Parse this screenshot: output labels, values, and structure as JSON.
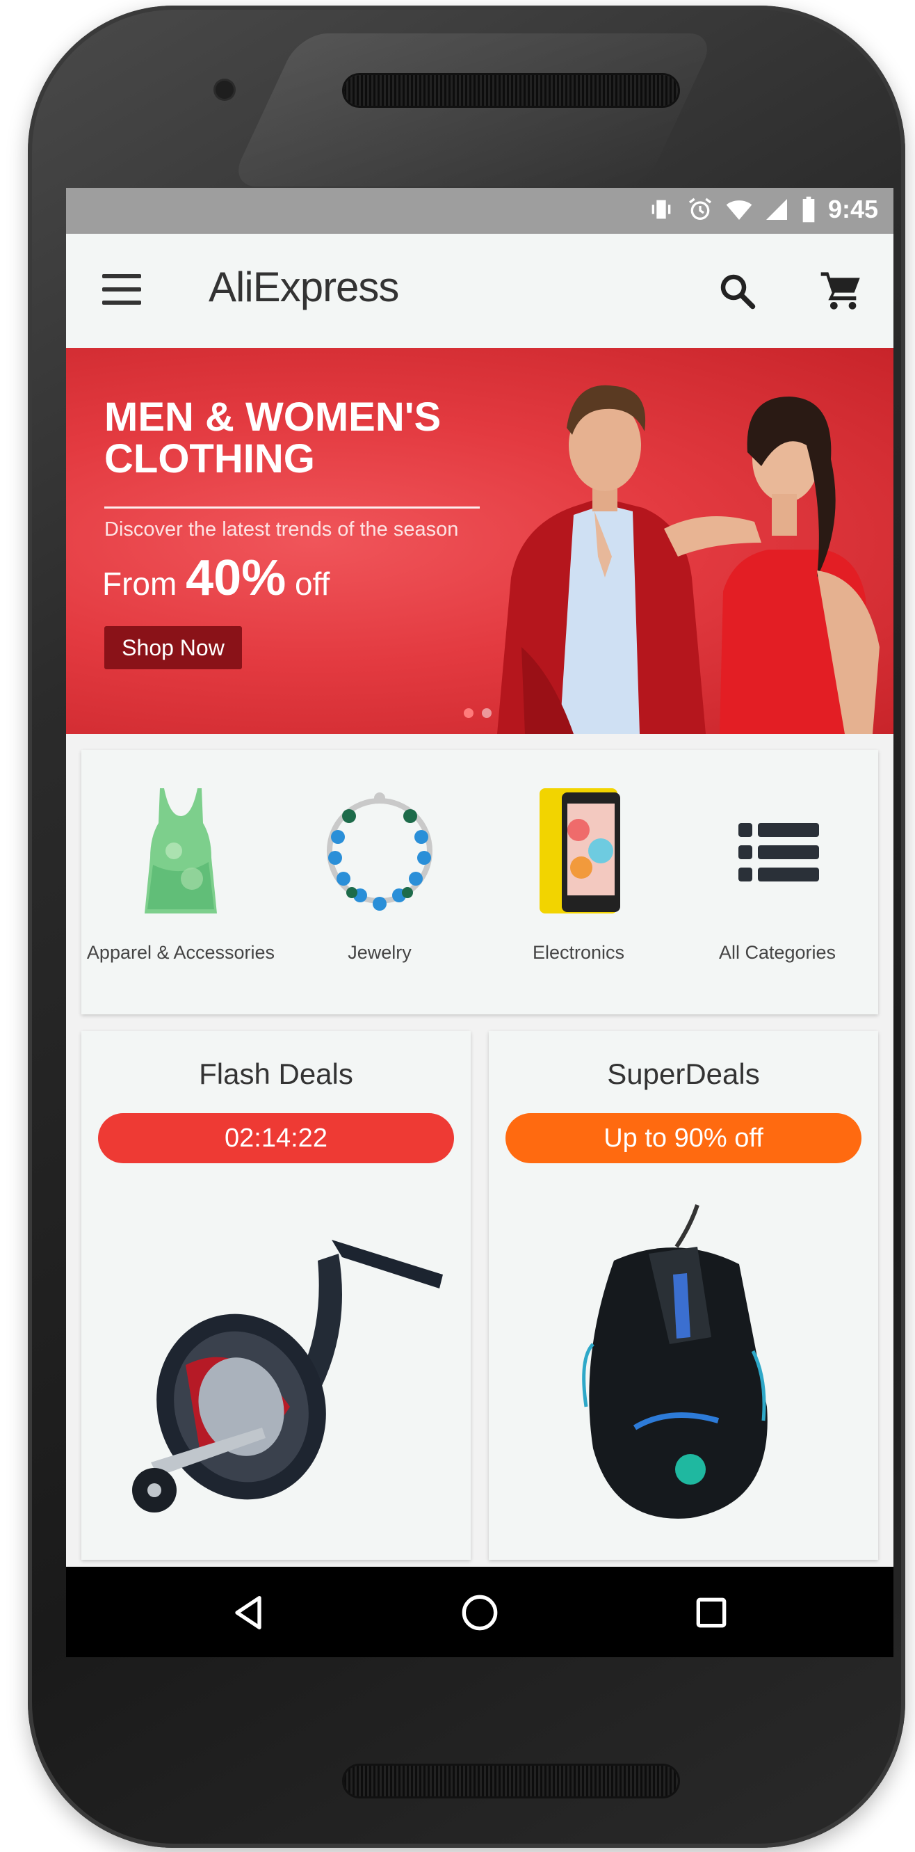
{
  "status_bar": {
    "time": "9:45"
  },
  "app_bar": {
    "title": "AliExpress"
  },
  "banner": {
    "title": "MEN & WOMEN'S CLOTHING",
    "subtitle": "Discover the latest trends of the season",
    "price_prefix": "From",
    "price_percent": "40%",
    "price_suffix": "off",
    "button_label": "Shop Now",
    "slide_count": 2,
    "active_slide": 1
  },
  "categories": [
    {
      "label": "Apparel & Accessories",
      "icon": "tank-top-icon"
    },
    {
      "label": "Jewelry",
      "icon": "necklace-icon"
    },
    {
      "label": "Electronics",
      "icon": "smartphone-icon"
    },
    {
      "label": "All Categories",
      "icon": "list-icon"
    }
  ],
  "flash_deals": {
    "title": "Flash Deals",
    "timer": "02:14:22",
    "pill_color": "#ee3a34",
    "image": "fishing-reel-icon"
  },
  "super_deals": {
    "title": "SuperDeals",
    "badge": "Up to 90% off",
    "pill_color": "#ff6a10",
    "image": "gaming-mouse-icon"
  },
  "colors": {
    "banner": "#e33a40",
    "status_bar": "#9e9e9e",
    "app_bar": "#f3f6f5"
  }
}
